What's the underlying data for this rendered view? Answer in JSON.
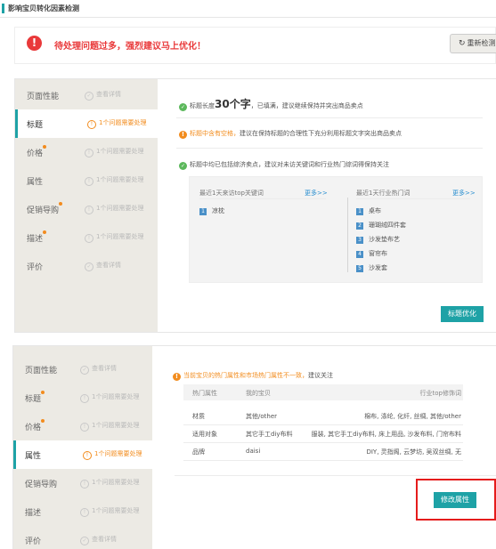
{
  "header": {
    "title": "影响宝贝转化因素检测"
  },
  "alert": {
    "text": "待处理问题过多，强烈建议马上优化！",
    "recheck_label": "重新检测"
  },
  "panel1": {
    "sidebar": [
      {
        "label": "页面性能",
        "status": "查看详情",
        "state": "ok",
        "dot": false
      },
      {
        "label": "标题",
        "status": "1个问题需要处理",
        "state": "active",
        "dot": false
      },
      {
        "label": "价格",
        "status": "1个问题需要处理",
        "state": "issue",
        "dot": true
      },
      {
        "label": "属性",
        "status": "1个问题需要处理",
        "state": "issue",
        "dot": false
      },
      {
        "label": "促销导购",
        "status": "1个问题需要处理",
        "state": "issue",
        "dot": true
      },
      {
        "label": "描述",
        "status": "1个问题需要处理",
        "state": "issue",
        "dot": true
      },
      {
        "label": "评价",
        "status": "查看详情",
        "state": "ok",
        "dot": false
      }
    ],
    "row1": {
      "pre": "标题长度",
      "count": "30个字",
      "post": "，已填满，建议继续保持并突出商品卖点"
    },
    "row2": {
      "warn": "标题中含有空格，",
      "rest": "建议在保持标题的合理性下充分利用标题文字突出商品卖点"
    },
    "row3": {
      "text": "标题中均已包括综济卖点，建议对未访关键词和行业热门综词得保持关注"
    },
    "keywords": {
      "left_title": "最近1天来访top关键词",
      "left_more": "更多>>",
      "left_items": [
        {
          "n": "1",
          "text": "凉枕"
        }
      ],
      "right_title": "最近1天行业热门词",
      "right_more": "更多>>",
      "right_items": [
        {
          "n": "1",
          "text": "桌布"
        },
        {
          "n": "2",
          "text": "珊瑚绒四件套"
        },
        {
          "n": "3",
          "text": "沙发垫布艺"
        },
        {
          "n": "4",
          "text": "窗帘布"
        },
        {
          "n": "5",
          "text": "沙发套"
        }
      ]
    },
    "optimize_label": "标题优化"
  },
  "panel2": {
    "sidebar": [
      {
        "label": "页面性能",
        "status": "查看详情",
        "state": "ok",
        "dot": false
      },
      {
        "label": "标题",
        "status": "1个问题需要处理",
        "state": "issue",
        "dot": true
      },
      {
        "label": "价格",
        "status": "1个问题需要处理",
        "state": "issue",
        "dot": true
      },
      {
        "label": "属性",
        "status": "1个问题需要处理",
        "state": "active",
        "dot": false
      },
      {
        "label": "促销导购",
        "status": "1个问题需要处理",
        "state": "issue",
        "dot": false
      },
      {
        "label": "描述",
        "status": "1个问题需要处理",
        "state": "issue",
        "dot": false
      },
      {
        "label": "评价",
        "status": "查看详情",
        "state": "ok",
        "dot": false
      }
    ],
    "notice": {
      "warn": "当前宝贝的热门属性和市场热门属性不一致，",
      "rest": "建议关注"
    },
    "table": {
      "headers": [
        "热门属性",
        "我的宝贝",
        "行业top修饰词"
      ],
      "rows": [
        [
          "材质",
          "其他/other",
          "棉布, 涤纶, 化纤, 丝绸, 其他/other"
        ],
        [
          "适用对象",
          "其它手工diy布料",
          "服装, 其它手工diy布料, 床上用品, 沙发布料, 门帘布料"
        ],
        [
          "品牌",
          "daisi",
          "DIY, 灵指阁, 云梦坊, 吴双丝绸, 无"
        ]
      ]
    },
    "modify_label": "修改属性"
  },
  "colors": {
    "accent": "#1ea2a6",
    "warning": "#f28c1e",
    "error": "#e9393a",
    "highlight": "#e51c1c"
  }
}
